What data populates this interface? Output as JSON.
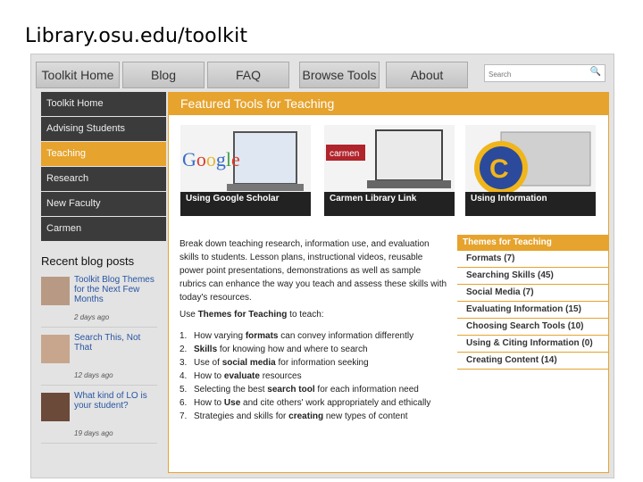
{
  "slide_title": "Library.osu.edu/toolkit",
  "nav": {
    "tabs": [
      "Toolkit Home",
      "Blog",
      "FAQ",
      "Browse Tools",
      "About"
    ],
    "search_placeholder": "Search"
  },
  "sidebar": {
    "items": [
      {
        "label": "Toolkit Home"
      },
      {
        "label": "Advising Students"
      },
      {
        "label": "Teaching"
      },
      {
        "label": "Research"
      },
      {
        "label": "New Faculty"
      },
      {
        "label": "Carmen"
      }
    ],
    "active": "Teaching"
  },
  "blog": {
    "heading": "Recent blog posts",
    "posts": [
      {
        "title": "Toolkit Blog Themes for the Next Few Months",
        "age": "2 days ago"
      },
      {
        "title": "Search This, Not That",
        "age": "12 days ago"
      },
      {
        "title": "What kind of LO is your student?",
        "age": "19 days ago"
      }
    ]
  },
  "featured": {
    "heading": "Featured Tools for Teaching",
    "tiles": [
      {
        "caption": "Using Google Scholar",
        "logo": "Google"
      },
      {
        "caption": "Carmen Library Link",
        "logo": "carmen"
      },
      {
        "caption": "Using Information",
        "logo": "©"
      }
    ]
  },
  "description": "Break down teaching research, information use, and evaluation skills to students. Lesson plans, instructional videos, reusable power point presentations, demonstrations as well as sample rubrics can enhance the way you teach and assess these skills with today's resources.",
  "use_line": {
    "prefix": "Use ",
    "bold": "Themes for Teaching",
    "suffix": " to teach:"
  },
  "steps": [
    {
      "num": "1.",
      "pre": "How varying ",
      "bold": "formats",
      "post": " can convey information differently"
    },
    {
      "num": "2.",
      "pre": "",
      "bold": "Skills",
      "post": " for knowing how and where to search"
    },
    {
      "num": "3.",
      "pre": "Use of ",
      "bold": "social media",
      "post": " for information seeking"
    },
    {
      "num": "4.",
      "pre": "How to ",
      "bold": "evaluate",
      "post": " resources"
    },
    {
      "num": "5.",
      "pre": "Selecting the best ",
      "bold": "search tool",
      "post": " for each information need"
    },
    {
      "num": "6.",
      "pre": "How to ",
      "bold": "Use",
      "post": " and cite others' work appropriately and ethically"
    },
    {
      "num": "7.",
      "pre": "Strategies and skills for ",
      "bold": "creating",
      "post": " new types of content"
    }
  ],
  "themes": {
    "heading": "Themes for Teaching",
    "items": [
      {
        "label": "Formats (7)"
      },
      {
        "label": "Searching Skills (45)"
      },
      {
        "label": "Social Media (7)"
      },
      {
        "label": "Evaluating Information (15)"
      },
      {
        "label": "Choosing Search Tools (10)"
      },
      {
        "label": "Using & Citing Information (0)"
      },
      {
        "label": "Creating Content (14)"
      }
    ]
  },
  "colors": {
    "accent": "#e6a32d",
    "sidebar": "#3b3b3b",
    "link": "#2855a3"
  }
}
